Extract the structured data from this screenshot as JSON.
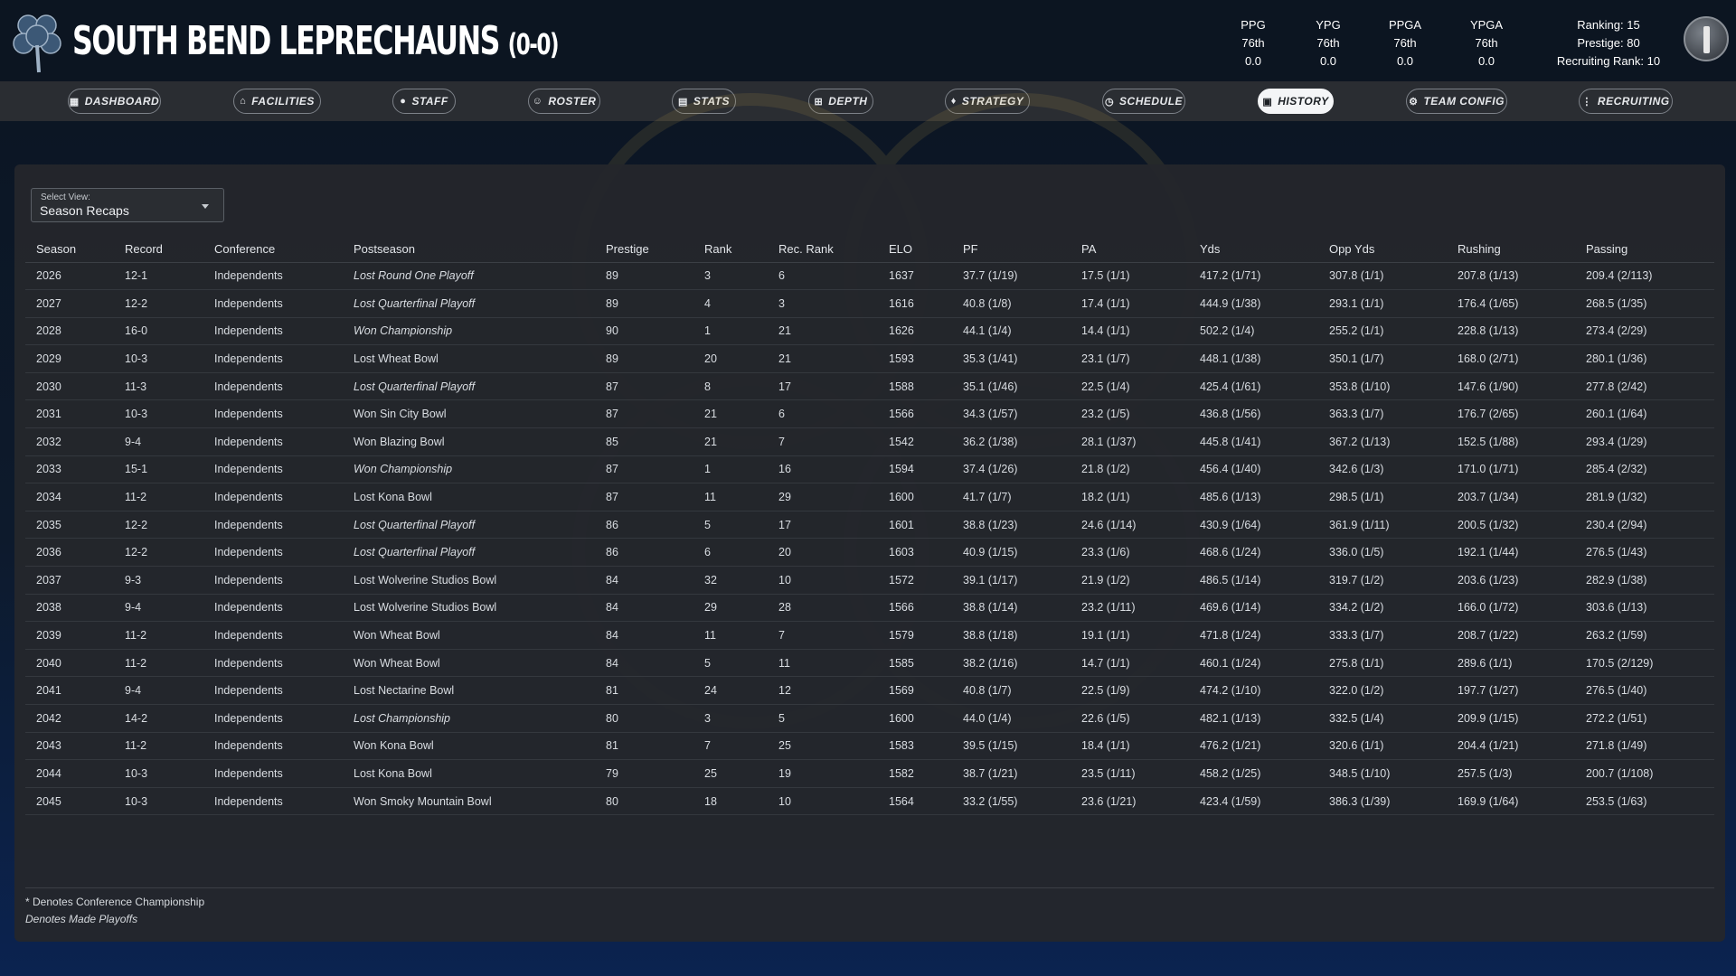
{
  "team": {
    "name": "SOUTH BEND LEPRECHAUNS",
    "record": "(0-0)"
  },
  "metrics": [
    {
      "label": "PPG",
      "rank": "76th",
      "value": "0.0"
    },
    {
      "label": "YPG",
      "rank": "76th",
      "value": "0.0"
    },
    {
      "label": "PPGA",
      "rank": "76th",
      "value": "0.0"
    },
    {
      "label": "YPGA",
      "rank": "76th",
      "value": "0.0"
    }
  ],
  "summary": {
    "ranking": "Ranking: 15",
    "prestige": "Prestige: 80",
    "recruiting": "Recruiting Rank: 10"
  },
  "colors": {
    "accent": "#c9a64a",
    "header_bg": "#0c1521",
    "nav_bg": "#2a2d32",
    "panel_bg": "#24272c"
  },
  "nav": [
    {
      "label": "DASHBOARD",
      "icon": "dashboard-icon"
    },
    {
      "label": "FACILITIES",
      "icon": "building-icon"
    },
    {
      "label": "STAFF",
      "icon": "person-icon"
    },
    {
      "label": "ROSTER",
      "icon": "people-icon"
    },
    {
      "label": "STATS",
      "icon": "chart-icon"
    },
    {
      "label": "DEPTH",
      "icon": "depth-icon"
    },
    {
      "label": "STRATEGY",
      "icon": "lightbulb-icon"
    },
    {
      "label": "SCHEDULE",
      "icon": "clock-icon"
    },
    {
      "label": "HISTORY",
      "icon": "history-icon",
      "active": true
    },
    {
      "label": "TEAM CONFIG",
      "icon": "gear-icon"
    },
    {
      "label": "RECRUITING",
      "icon": "recruit-icon"
    }
  ],
  "view_select": {
    "label": "Select View:",
    "value": "Season Recaps"
  },
  "table": {
    "headers": [
      "Season",
      "Record",
      "Conference",
      "Postseason",
      "Prestige",
      "Rank",
      "Rec. Rank",
      "ELO",
      "PF",
      "PA",
      "Yds",
      "Opp Yds",
      "Rushing",
      "Passing"
    ],
    "rows": [
      {
        "season": "2026",
        "record": "12-1",
        "conference": "Independents",
        "postseason": "Lost Round One Playoff",
        "playoff": true,
        "prestige": "89",
        "rank": "3",
        "rec_rank": "6",
        "elo": "1637",
        "pf": "37.7 (1/19)",
        "pa": "17.5 (1/1)",
        "yds": "417.2 (1/71)",
        "opp_yds": "307.8 (1/1)",
        "rushing": "207.8 (1/13)",
        "passing": "209.4 (2/113)"
      },
      {
        "season": "2027",
        "record": "12-2",
        "conference": "Independents",
        "postseason": "Lost Quarterfinal Playoff",
        "playoff": true,
        "prestige": "89",
        "rank": "4",
        "rec_rank": "3",
        "elo": "1616",
        "pf": "40.8 (1/8)",
        "pa": "17.4 (1/1)",
        "yds": "444.9 (1/38)",
        "opp_yds": "293.1 (1/1)",
        "rushing": "176.4 (1/65)",
        "passing": "268.5 (1/35)"
      },
      {
        "season": "2028",
        "record": "16-0",
        "conference": "Independents",
        "postseason": "Won Championship",
        "playoff": true,
        "prestige": "90",
        "rank": "1",
        "rec_rank": "21",
        "elo": "1626",
        "pf": "44.1 (1/4)",
        "pa": "14.4 (1/1)",
        "yds": "502.2 (1/4)",
        "opp_yds": "255.2 (1/1)",
        "rushing": "228.8 (1/13)",
        "passing": "273.4 (2/29)"
      },
      {
        "season": "2029",
        "record": "10-3",
        "conference": "Independents",
        "postseason": "Lost Wheat Bowl",
        "playoff": false,
        "prestige": "89",
        "rank": "20",
        "rec_rank": "21",
        "elo": "1593",
        "pf": "35.3 (1/41)",
        "pa": "23.1 (1/7)",
        "yds": "448.1 (1/38)",
        "opp_yds": "350.1 (1/7)",
        "rushing": "168.0 (2/71)",
        "passing": "280.1 (1/36)"
      },
      {
        "season": "2030",
        "record": "11-3",
        "conference": "Independents",
        "postseason": "Lost Quarterfinal Playoff",
        "playoff": true,
        "prestige": "87",
        "rank": "8",
        "rec_rank": "17",
        "elo": "1588",
        "pf": "35.1 (1/46)",
        "pa": "22.5 (1/4)",
        "yds": "425.4 (1/61)",
        "opp_yds": "353.8 (1/10)",
        "rushing": "147.6 (1/90)",
        "passing": "277.8 (2/42)"
      },
      {
        "season": "2031",
        "record": "10-3",
        "conference": "Independents",
        "postseason": "Won Sin City Bowl",
        "playoff": false,
        "prestige": "87",
        "rank": "21",
        "rec_rank": "6",
        "elo": "1566",
        "pf": "34.3 (1/57)",
        "pa": "23.2 (1/5)",
        "yds": "436.8 (1/56)",
        "opp_yds": "363.3 (1/7)",
        "rushing": "176.7 (2/65)",
        "passing": "260.1 (1/64)"
      },
      {
        "season": "2032",
        "record": "9-4",
        "conference": "Independents",
        "postseason": "Won Blazing Bowl",
        "playoff": false,
        "prestige": "85",
        "rank": "21",
        "rec_rank": "7",
        "elo": "1542",
        "pf": "36.2 (1/38)",
        "pa": "28.1 (1/37)",
        "yds": "445.8 (1/41)",
        "opp_yds": "367.2 (1/13)",
        "rushing": "152.5 (1/88)",
        "passing": "293.4 (1/29)"
      },
      {
        "season": "2033",
        "record": "15-1",
        "conference": "Independents",
        "postseason": "Won Championship",
        "playoff": true,
        "prestige": "87",
        "rank": "1",
        "rec_rank": "16",
        "elo": "1594",
        "pf": "37.4 (1/26)",
        "pa": "21.8 (1/2)",
        "yds": "456.4 (1/40)",
        "opp_yds": "342.6 (1/3)",
        "rushing": "171.0 (1/71)",
        "passing": "285.4 (2/32)"
      },
      {
        "season": "2034",
        "record": "11-2",
        "conference": "Independents",
        "postseason": "Lost Kona Bowl",
        "playoff": false,
        "prestige": "87",
        "rank": "11",
        "rec_rank": "29",
        "elo": "1600",
        "pf": "41.7 (1/7)",
        "pa": "18.2 (1/1)",
        "yds": "485.6 (1/13)",
        "opp_yds": "298.5 (1/1)",
        "rushing": "203.7 (1/34)",
        "passing": "281.9 (1/32)"
      },
      {
        "season": "2035",
        "record": "12-2",
        "conference": "Independents",
        "postseason": "Lost Quarterfinal Playoff",
        "playoff": true,
        "prestige": "86",
        "rank": "5",
        "rec_rank": "17",
        "elo": "1601",
        "pf": "38.8 (1/23)",
        "pa": "24.6 (1/14)",
        "yds": "430.9 (1/64)",
        "opp_yds": "361.9 (1/11)",
        "rushing": "200.5 (1/32)",
        "passing": "230.4 (2/94)"
      },
      {
        "season": "2036",
        "record": "12-2",
        "conference": "Independents",
        "postseason": "Lost Quarterfinal Playoff",
        "playoff": true,
        "prestige": "86",
        "rank": "6",
        "rec_rank": "20",
        "elo": "1603",
        "pf": "40.9 (1/15)",
        "pa": "23.3 (1/6)",
        "yds": "468.6 (1/24)",
        "opp_yds": "336.0 (1/5)",
        "rushing": "192.1 (1/44)",
        "passing": "276.5 (1/43)"
      },
      {
        "season": "2037",
        "record": "9-3",
        "conference": "Independents",
        "postseason": "Lost Wolverine Studios Bowl",
        "playoff": false,
        "prestige": "84",
        "rank": "32",
        "rec_rank": "10",
        "elo": "1572",
        "pf": "39.1 (1/17)",
        "pa": "21.9 (1/2)",
        "yds": "486.5 (1/14)",
        "opp_yds": "319.7 (1/2)",
        "rushing": "203.6 (1/23)",
        "passing": "282.9 (1/38)"
      },
      {
        "season": "2038",
        "record": "9-4",
        "conference": "Independents",
        "postseason": "Lost Wolverine Studios Bowl",
        "playoff": false,
        "prestige": "84",
        "rank": "29",
        "rec_rank": "28",
        "elo": "1566",
        "pf": "38.8 (1/14)",
        "pa": "23.2 (1/11)",
        "yds": "469.6 (1/14)",
        "opp_yds": "334.2 (1/2)",
        "rushing": "166.0 (1/72)",
        "passing": "303.6 (1/13)"
      },
      {
        "season": "2039",
        "record": "11-2",
        "conference": "Independents",
        "postseason": "Won Wheat Bowl",
        "playoff": false,
        "prestige": "84",
        "rank": "11",
        "rec_rank": "7",
        "elo": "1579",
        "pf": "38.8 (1/18)",
        "pa": "19.1 (1/1)",
        "yds": "471.8 (1/24)",
        "opp_yds": "333.3 (1/7)",
        "rushing": "208.7 (1/22)",
        "passing": "263.2 (1/59)"
      },
      {
        "season": "2040",
        "record": "11-2",
        "conference": "Independents",
        "postseason": "Won Wheat Bowl",
        "playoff": false,
        "prestige": "84",
        "rank": "5",
        "rec_rank": "11",
        "elo": "1585",
        "pf": "38.2 (1/16)",
        "pa": "14.7 (1/1)",
        "yds": "460.1 (1/24)",
        "opp_yds": "275.8 (1/1)",
        "rushing": "289.6 (1/1)",
        "passing": "170.5 (2/129)"
      },
      {
        "season": "2041",
        "record": "9-4",
        "conference": "Independents",
        "postseason": "Lost Nectarine Bowl",
        "playoff": false,
        "prestige": "81",
        "rank": "24",
        "rec_rank": "12",
        "elo": "1569",
        "pf": "40.8 (1/7)",
        "pa": "22.5 (1/9)",
        "yds": "474.2 (1/10)",
        "opp_yds": "322.0 (1/2)",
        "rushing": "197.7 (1/27)",
        "passing": "276.5 (1/40)"
      },
      {
        "season": "2042",
        "record": "14-2",
        "conference": "Independents",
        "postseason": "Lost Championship",
        "playoff": true,
        "prestige": "80",
        "rank": "3",
        "rec_rank": "5",
        "elo": "1600",
        "pf": "44.0 (1/4)",
        "pa": "22.6 (1/5)",
        "yds": "482.1 (1/13)",
        "opp_yds": "332.5 (1/4)",
        "rushing": "209.9 (1/15)",
        "passing": "272.2 (1/51)"
      },
      {
        "season": "2043",
        "record": "11-2",
        "conference": "Independents",
        "postseason": "Won Kona Bowl",
        "playoff": false,
        "prestige": "81",
        "rank": "7",
        "rec_rank": "25",
        "elo": "1583",
        "pf": "39.5 (1/15)",
        "pa": "18.4 (1/1)",
        "yds": "476.2 (1/21)",
        "opp_yds": "320.6 (1/1)",
        "rushing": "204.4 (1/21)",
        "passing": "271.8 (1/49)"
      },
      {
        "season": "2044",
        "record": "10-3",
        "conference": "Independents",
        "postseason": "Lost Kona Bowl",
        "playoff": false,
        "prestige": "79",
        "rank": "25",
        "rec_rank": "19",
        "elo": "1582",
        "pf": "38.7 (1/21)",
        "pa": "23.5 (1/11)",
        "yds": "458.2 (1/25)",
        "opp_yds": "348.5 (1/10)",
        "rushing": "257.5 (1/3)",
        "passing": "200.7 (1/108)"
      },
      {
        "season": "2045",
        "record": "10-3",
        "conference": "Independents",
        "postseason": "Won Smoky Mountain Bowl",
        "playoff": false,
        "prestige": "80",
        "rank": "18",
        "rec_rank": "10",
        "elo": "1564",
        "pf": "33.2 (1/55)",
        "pa": "23.6 (1/21)",
        "yds": "423.4 (1/59)",
        "opp_yds": "386.3 (1/39)",
        "rushing": "169.9 (1/64)",
        "passing": "253.5 (1/63)"
      }
    ]
  },
  "notes": {
    "conference": "* Denotes Conference Championship",
    "playoffs": "Denotes Made Playoffs"
  }
}
